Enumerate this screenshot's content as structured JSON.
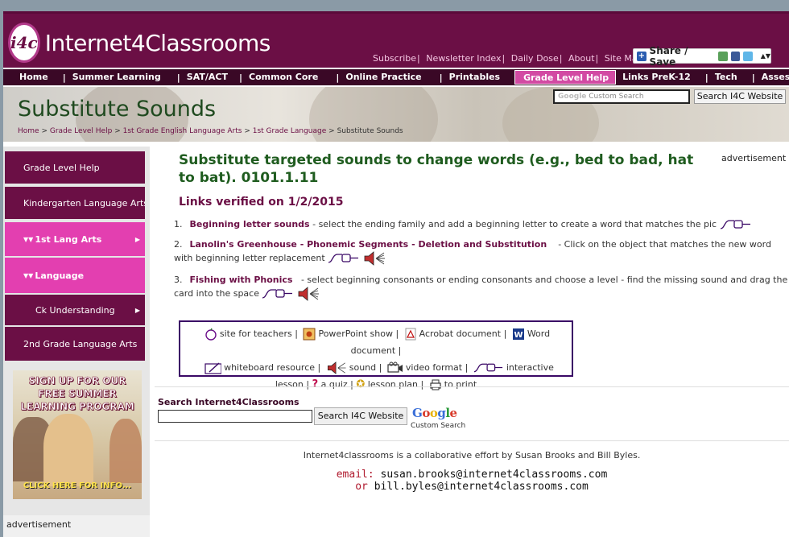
{
  "header": {
    "logo_badge": "i4c",
    "logo_text": "Internet4Classrooms",
    "top_links": [
      "Subscribe",
      "Newsletter Index",
      "Daily Dose",
      "About",
      "Site Map"
    ],
    "share_label": "Share / Save"
  },
  "nav": {
    "items": [
      "Home",
      "Summer Learning",
      "SAT/ACT",
      "Common Core",
      "Online Practice",
      "Printables",
      "Grade Level Help",
      "Links PreK-12",
      "Tech",
      "Assessment"
    ],
    "active": "Grade Level Help",
    "separator": "|"
  },
  "banner": {
    "title": "Substitute Sounds",
    "search_placeholder": "Custom Search",
    "search_button": "Search I4C Website",
    "breadcrumb": [
      "Home",
      "Grade Level Help",
      "1st Grade English Language Arts",
      "1st Grade Language",
      "Substitute Sounds"
    ],
    "breadcrumb_sep": ">"
  },
  "sidebar": {
    "items": [
      {
        "label": "Grade Level Help",
        "style": "dark"
      },
      {
        "label": "Kindergarten Language Arts",
        "style": "dark"
      },
      {
        "label": "1st Lang Arts",
        "style": "pink"
      },
      {
        "label": "Language",
        "style": "pink"
      },
      {
        "label": "Ck Understanding",
        "style": "dark"
      },
      {
        "label": "2nd Grade Language Arts",
        "style": "dark"
      }
    ],
    "promo_lines": [
      "SIGN UP FOR OUR",
      "FREE SUMMER",
      "LEARNING PROGRAM"
    ],
    "promo_cta": "CLICK HERE FOR INFO...",
    "advertisement": "advertisement"
  },
  "main": {
    "title": "Substitute targeted sounds to change words (e.g., bed to bad, hat to bat). 0101.1.11",
    "advertisement": "advertisement",
    "verified": "Links verified on 1/2/2015",
    "links": [
      {
        "num": "1.",
        "title": "Beginning letter sounds",
        "desc": " - select the ending family and add a beginning letter to create a word that matches the pic"
      },
      {
        "num": "2.",
        "title": "Lanolin's Greenhouse - Phonemic Segments - Deletion and Substitution",
        "desc": "- Click on the object that matches the new word with beginning letter replacement"
      },
      {
        "num": "3.",
        "title": "Fishing with Phonics",
        "desc": " - select beginning consonants or ending consonants and choose a level - find the missing sound and drag the card into the space"
      }
    ],
    "legend": {
      "site_for_teachers": "site for teachers",
      "powerpoint": "PowerPoint show",
      "acrobat": "Acrobat document",
      "word": "Word document",
      "whiteboard": "whiteboard resource",
      "sound": "sound",
      "video": "video format",
      "interactive": "interactive lesson",
      "quiz": "a quiz",
      "lesson_plan": "lesson plan",
      "print": "to print",
      "sep": "|"
    },
    "search_label": "Search Internet4Classrooms",
    "search_button": "Search I4C Website",
    "google_sub": "Custom Search",
    "footer": "Internet4classrooms is a collaborative effort by Susan Brooks and Bill Byles.",
    "email_label": "email:",
    "email1": "susan.brooks@internet4classrooms.com",
    "or_label": "or",
    "email2": "bill.byles@internet4classrooms.com"
  },
  "colors": {
    "brand": "#6b0f45",
    "nav_bg": "#3a0826",
    "active_pink": "#d24aa3",
    "title_green": "#1f5c1f"
  }
}
